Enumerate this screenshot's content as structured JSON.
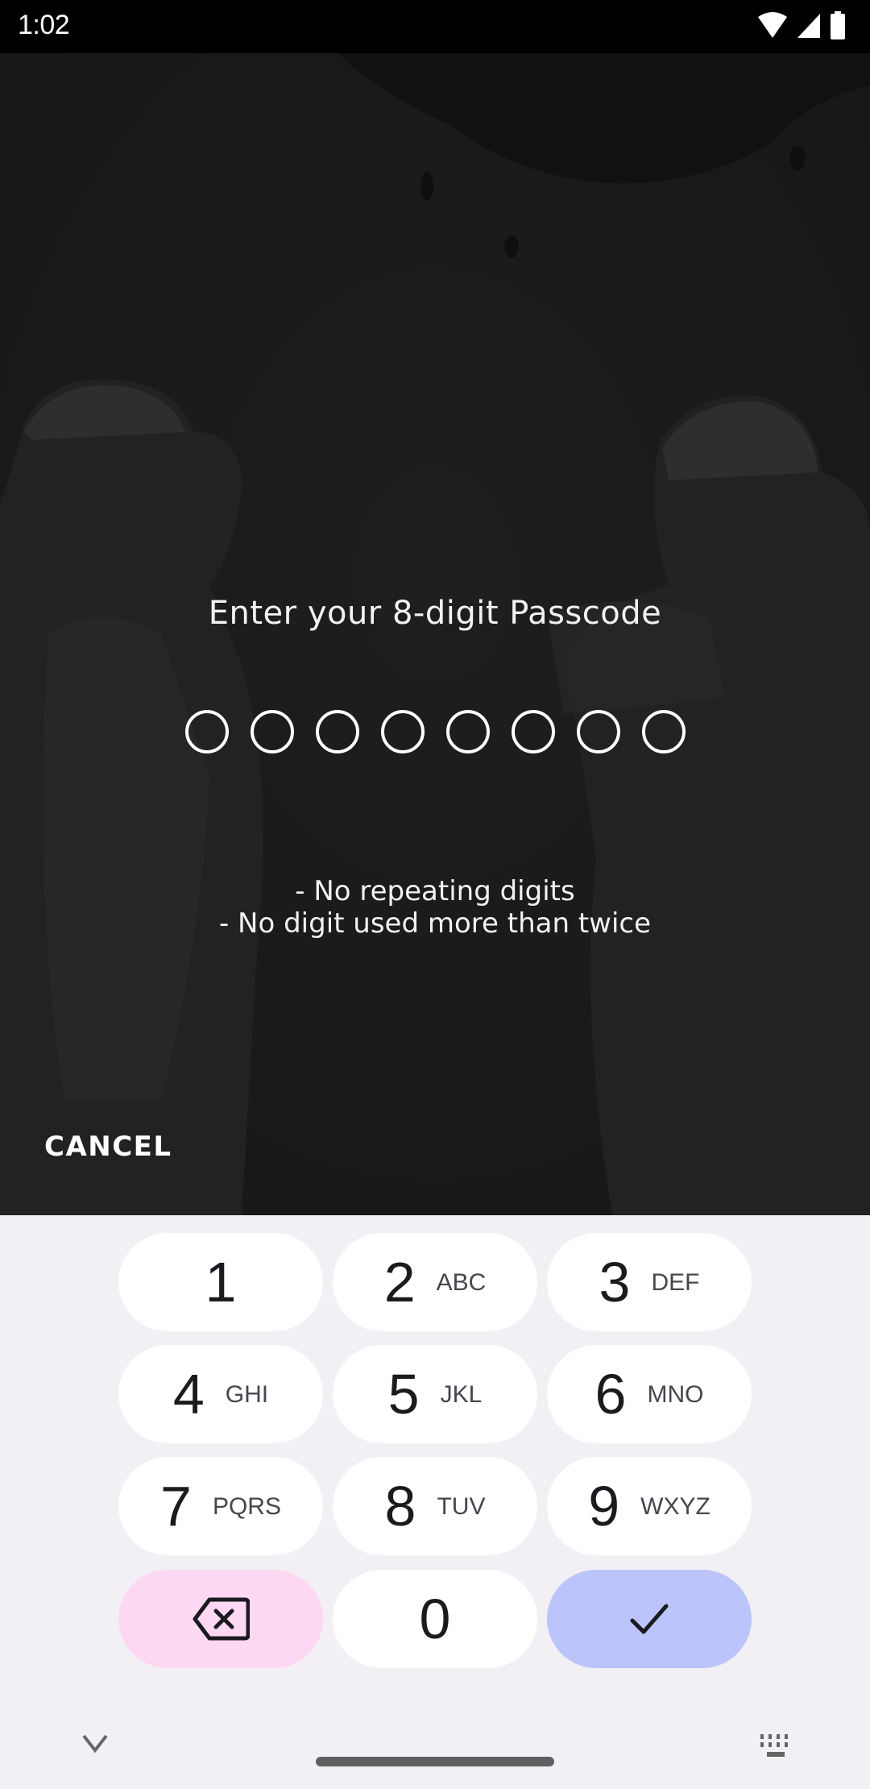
{
  "status_bar": {
    "time": "1:02",
    "icons": [
      "wifi-icon",
      "cellular-signal-icon",
      "battery-icon"
    ]
  },
  "passcode": {
    "prompt": "Enter your 8-digit Passcode",
    "length": 8,
    "entered": 0,
    "rules": [
      "- No repeating digits",
      "- No digit used more than twice"
    ],
    "cancel_label": "CANCEL"
  },
  "keypad": {
    "keys": [
      {
        "digit": "1",
        "letters": ""
      },
      {
        "digit": "2",
        "letters": "ABC"
      },
      {
        "digit": "3",
        "letters": "DEF"
      },
      {
        "digit": "4",
        "letters": "GHI"
      },
      {
        "digit": "5",
        "letters": "JKL"
      },
      {
        "digit": "6",
        "letters": "MNO"
      },
      {
        "digit": "7",
        "letters": "PQRS"
      },
      {
        "digit": "8",
        "letters": "TUV"
      },
      {
        "digit": "9",
        "letters": "WXYZ"
      },
      {
        "digit": "0",
        "letters": ""
      }
    ],
    "delete_icon": "backspace-icon",
    "confirm_icon": "checkmark-icon",
    "colors": {
      "background": "#f2f0f4",
      "key": "#ffffff",
      "delete_key": "#fdd8f3",
      "confirm_key": "#bbc5fb"
    }
  },
  "nav": {
    "collapse_icon": "chevron-down-icon",
    "switch_keyboard_icon": "keyboard-icon"
  }
}
